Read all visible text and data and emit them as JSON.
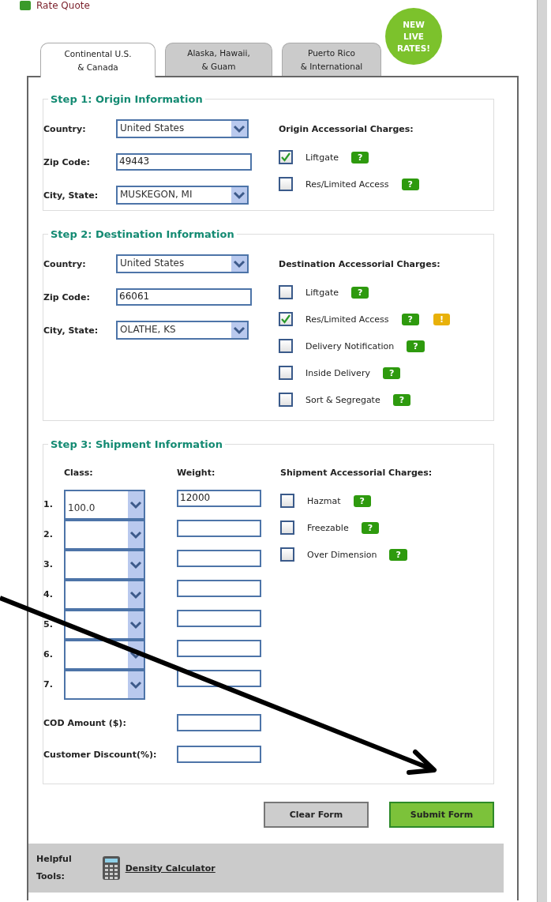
{
  "header": {
    "title": "Rate Quote"
  },
  "badge": {
    "lines": [
      "NEW",
      "LIVE",
      "RATES!"
    ]
  },
  "tabs": [
    {
      "lines": [
        "Continental U.S.",
        "& Canada"
      ],
      "selected": true
    },
    {
      "lines": [
        "Alaska, Hawaii,",
        "& Guam"
      ],
      "selected": false
    },
    {
      "lines": [
        "Puerto Rico",
        "& International"
      ],
      "selected": false
    }
  ],
  "origin": {
    "legend": "Step 1: Origin Information",
    "fields": [
      {
        "label": "Country:",
        "value": "United States",
        "kind": "select"
      },
      {
        "label": "Zip Code:",
        "value": "49443",
        "kind": "text"
      },
      {
        "label": "City, State:",
        "value": "MUSKEGON, MI",
        "kind": "select"
      }
    ],
    "charges_title": "Origin Accessorial Charges:",
    "charges": [
      {
        "label": "Liftgate",
        "checked": true,
        "help": "?"
      },
      {
        "label": "Res/Limited Access",
        "checked": false,
        "help": "?"
      }
    ]
  },
  "destination": {
    "legend": "Step 2: Destination Information",
    "fields": [
      {
        "label": "Country:",
        "value": "United States",
        "kind": "select"
      },
      {
        "label": "Zip Code:",
        "value": "66061",
        "kind": "text"
      },
      {
        "label": "City, State:",
        "value": "OLATHE, KS",
        "kind": "select"
      }
    ],
    "charges_title": "Destination Accessorial Charges:",
    "charges": [
      {
        "label": "Liftgate",
        "checked": false,
        "help": "?"
      },
      {
        "label": "Res/Limited Access",
        "checked": true,
        "help": "?",
        "warning": "!"
      },
      {
        "label": "Delivery Notification",
        "checked": false,
        "help": "?"
      },
      {
        "label": "Inside Delivery",
        "checked": false,
        "help": "?"
      },
      {
        "label": "Sort & Segregate",
        "checked": false,
        "help": "?"
      }
    ]
  },
  "shipment": {
    "legend": "Step 3:  Shipment Information",
    "class_header": "Class:",
    "weight_header": "Weight:",
    "rows": [
      {
        "number": "1.",
        "class": "100.0",
        "weight": "12000"
      },
      {
        "number": "2."
      },
      {
        "number": "3."
      },
      {
        "number": "4."
      },
      {
        "number": "5."
      },
      {
        "number": "6."
      },
      {
        "number": "7."
      }
    ],
    "cod_label": "COD Amount ($):",
    "discount_label": "Customer Discount(%):",
    "charges_title": "Shipment Accessorial Charges:",
    "charges": [
      {
        "label": "Hazmat",
        "checked": false,
        "help": "?"
      },
      {
        "label": "Freezable",
        "checked": false,
        "help": "?"
      },
      {
        "label": "Over Dimension",
        "checked": false,
        "help": "?"
      }
    ]
  },
  "buttons": [
    {
      "label": "Clear Form",
      "kind": "secondary"
    },
    {
      "label": "Submit Form",
      "kind": "primary"
    }
  ],
  "tools": {
    "lines": [
      "Helpful",
      "Tools:"
    ],
    "link": "Density Calculator"
  }
}
